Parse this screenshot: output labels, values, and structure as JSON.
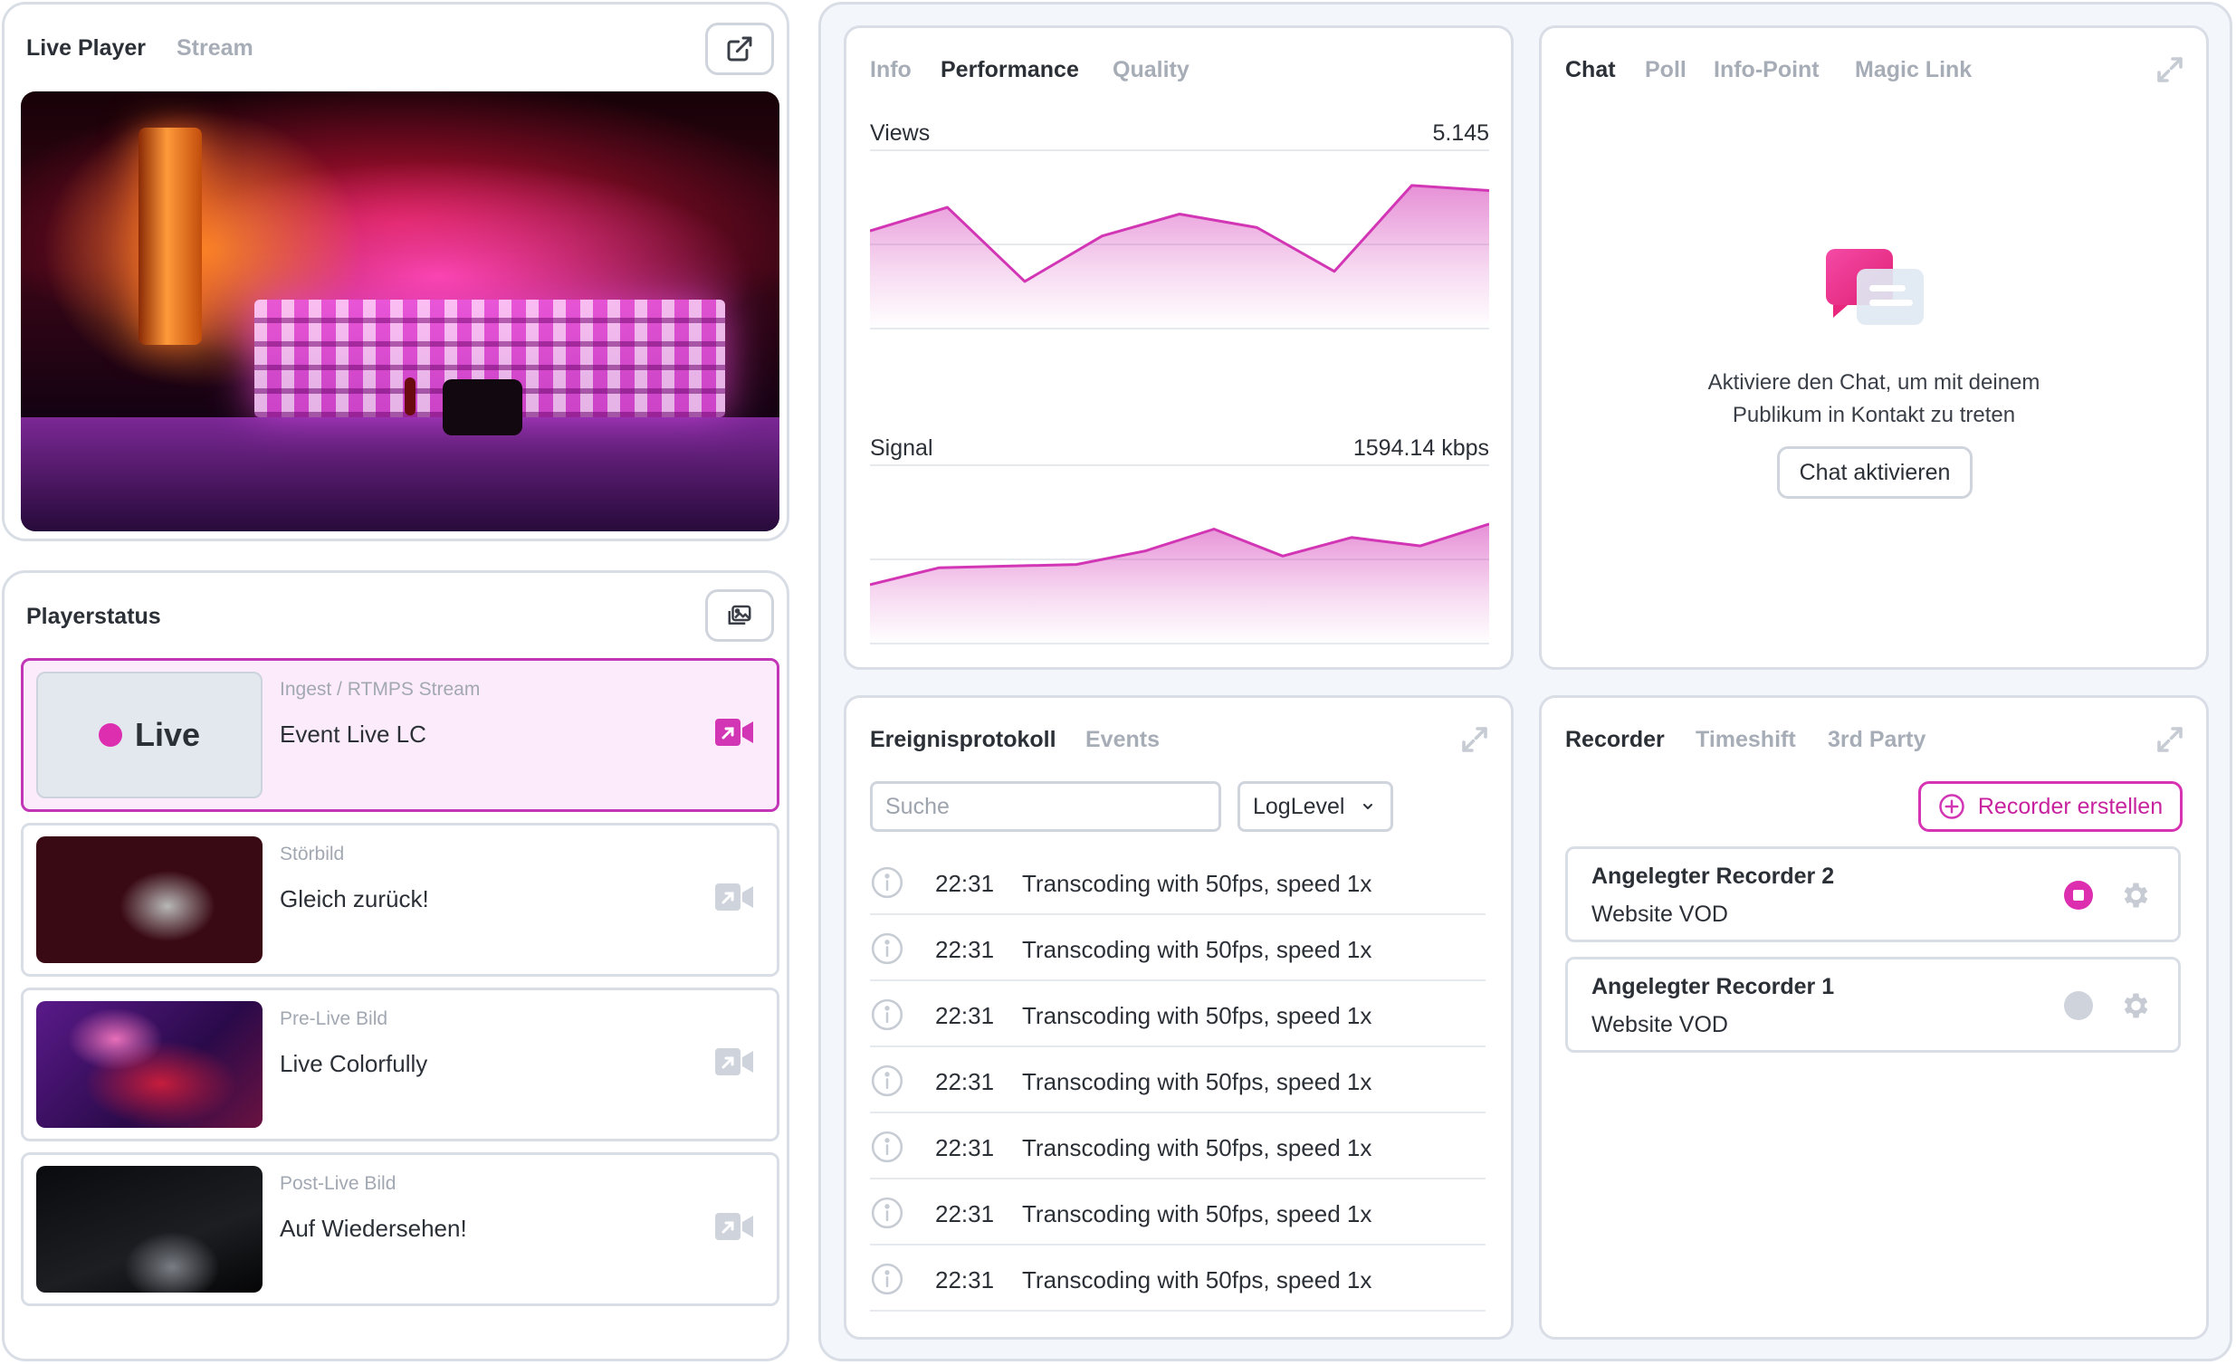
{
  "live_player": {
    "tabs": [
      "Live Player",
      "Stream"
    ],
    "active_tab": "Live Player",
    "popout_icon": "external-link-icon"
  },
  "player_status": {
    "title": "Playerstatus",
    "action_icon": "images-icon",
    "items": [
      {
        "state": "Live",
        "subtitle": "Ingest / RTMPS Stream",
        "title": "Event Live LC",
        "active": true
      },
      {
        "subtitle": "Störbild",
        "title": "Gleich zurück!",
        "active": false
      },
      {
        "subtitle": "Pre-Live Bild",
        "title": "Live Colorfully",
        "active": false
      },
      {
        "subtitle": "Post-Live Bild",
        "title": "Auf Wiedersehen!",
        "active": false
      }
    ]
  },
  "performance": {
    "tabs": [
      "Info",
      "Performance",
      "Quality"
    ],
    "active_tab": "Performance",
    "charts": {
      "views": {
        "label": "Views",
        "value": "5.145"
      },
      "signal": {
        "label": "Signal",
        "value": "1594.14 kbps"
      }
    }
  },
  "chart_data": [
    {
      "type": "area",
      "title": "Views",
      "x": [
        0,
        1,
        2,
        3,
        4,
        5,
        6,
        7,
        8
      ],
      "values": [
        0.58,
        0.72,
        0.28,
        0.55,
        0.68,
        0.6,
        0.34,
        0.85,
        0.82
      ],
      "color": "#d236b5",
      "grid": true
    },
    {
      "type": "area",
      "title": "Signal",
      "x": [
        0,
        1,
        2,
        3,
        4,
        5,
        6,
        7,
        8,
        9
      ],
      "values": [
        0.35,
        0.45,
        0.46,
        0.47,
        0.55,
        0.68,
        0.52,
        0.63,
        0.58,
        0.71
      ],
      "color": "#d236b5",
      "grid": true
    }
  ],
  "chat": {
    "tabs": [
      "Chat",
      "Poll",
      "Info-Point",
      "Magic Link"
    ],
    "active_tab": "Chat",
    "message_line1": "Aktiviere den Chat, um mit deinem",
    "message_line2": "Publikum in Kontakt zu treten",
    "button": "Chat aktivieren"
  },
  "log": {
    "tabs": [
      "Ereignisprotokoll",
      "Events"
    ],
    "active_tab": "Ereignisprotokoll",
    "search_placeholder": "Suche",
    "level_select": "LogLevel",
    "rows": [
      {
        "time": "22:31",
        "message": "Transcoding with 50fps, speed 1x"
      },
      {
        "time": "22:31",
        "message": "Transcoding with 50fps, speed 1x"
      },
      {
        "time": "22:31",
        "message": "Transcoding with 50fps, speed 1x"
      },
      {
        "time": "22:31",
        "message": "Transcoding with 50fps, speed 1x"
      },
      {
        "time": "22:31",
        "message": "Transcoding with 50fps, speed 1x"
      },
      {
        "time": "22:31",
        "message": "Transcoding with 50fps, speed 1x"
      },
      {
        "time": "22:31",
        "message": "Transcoding with 50fps, speed 1x"
      }
    ]
  },
  "recorder": {
    "tabs": [
      "Recorder",
      "Timeshift",
      "3rd Party"
    ],
    "active_tab": "Recorder",
    "create_button": "Recorder erstellen",
    "items": [
      {
        "title": "Angelegter Recorder 2",
        "subtitle": "Website VOD",
        "recording": true,
        "status_color": "#de2eb0"
      },
      {
        "title": "Angelegter Recorder 1",
        "subtitle": "Website VOD",
        "recording": false,
        "status_color": "#cfd4dc"
      }
    ]
  },
  "colors": {
    "accent": "#d236b5",
    "border": "#d9dee6",
    "muted_text": "#a7adb7"
  }
}
